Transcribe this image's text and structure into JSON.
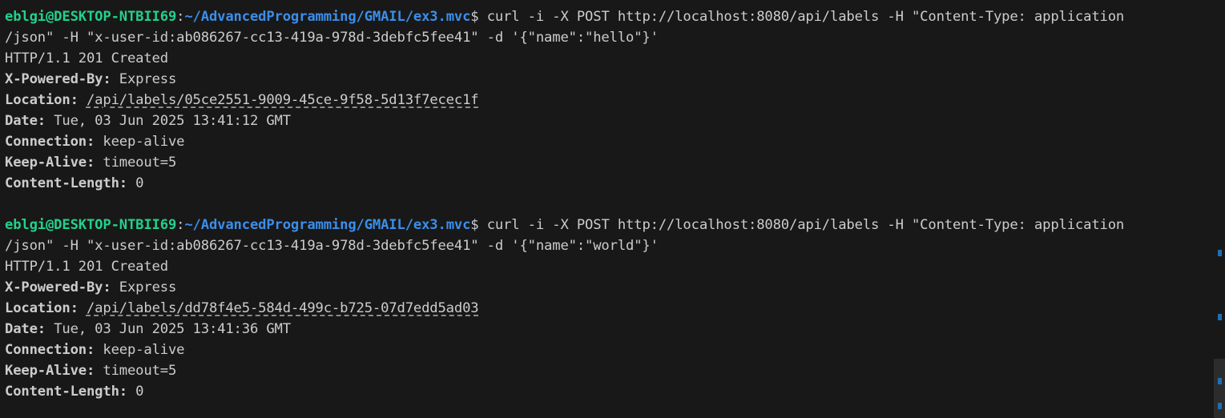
{
  "terminal": {
    "block1": {
      "prompt_user": "eblgi@DESKTOP-NTBII69",
      "prompt_colon": ":",
      "prompt_path": "~/AdvancedProgramming/GMAIL/ex3.mvc",
      "prompt_symbol": "$ ",
      "command_line1": "curl -i -X POST http://localhost:8080/api/labels -H \"Content-Type: application",
      "command_line2": "/json\" -H \"x-user-id:ab086267-cc13-419a-978d-3debfc5fee41\" -d '{\"name\":\"hello\"}'",
      "status": "HTTP/1.1 201 Created",
      "headers": [
        {
          "key": "X-Powered-By:",
          "value": " Express"
        },
        {
          "key": "Location:",
          "value": "/api/labels/05ce2551-9009-45ce-9f58-5d13f7ecec1f"
        },
        {
          "key": "Date:",
          "value": " Tue, 03 Jun 2025 13:41:12 GMT"
        },
        {
          "key": "Connection:",
          "value": " keep-alive"
        },
        {
          "key": "Keep-Alive:",
          "value": " timeout=5"
        },
        {
          "key": "Content-Length:",
          "value": " 0"
        }
      ]
    },
    "block2": {
      "prompt_user": "eblgi@DESKTOP-NTBII69",
      "prompt_colon": ":",
      "prompt_path": "~/AdvancedProgramming/GMAIL/ex3.mvc",
      "prompt_symbol": "$ ",
      "command_line1": "curl -i -X POST http://localhost:8080/api/labels -H \"Content-Type: application",
      "command_line2": "/json\" -H \"x-user-id:ab086267-cc13-419a-978d-3debfc5fee41\" -d '{\"name\":\"world\"}'",
      "status": "HTTP/1.1 201 Created",
      "headers": [
        {
          "key": "X-Powered-By:",
          "value": " Express"
        },
        {
          "key": "Location:",
          "value": "/api/labels/dd78f4e5-584d-499c-b725-07d7edd5ad03"
        },
        {
          "key": "Date:",
          "value": " Tue, 03 Jun 2025 13:41:36 GMT"
        },
        {
          "key": "Connection:",
          "value": " keep-alive"
        },
        {
          "key": "Keep-Alive:",
          "value": " timeout=5"
        },
        {
          "key": "Content-Length:",
          "value": " 0"
        }
      ]
    }
  },
  "colors": {
    "background": "#181818",
    "text": "#cccccc",
    "prompt_user": "#23d18b",
    "prompt_path": "#3b8eea",
    "scroll_marker": "#1f6fb2"
  }
}
